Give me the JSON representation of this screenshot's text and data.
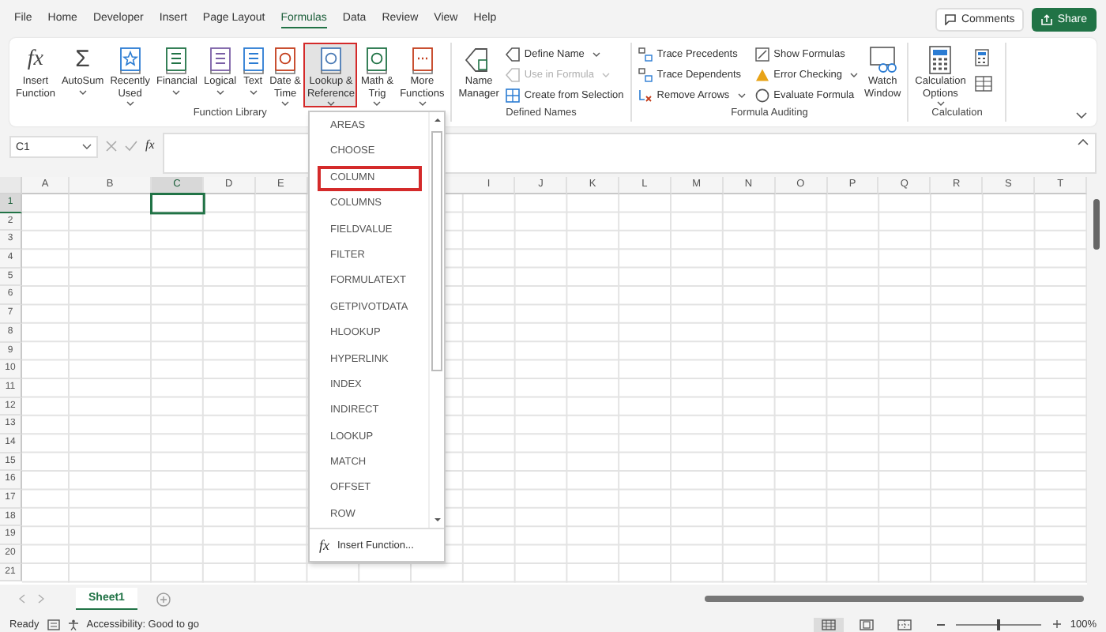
{
  "tabs": [
    {
      "label": "File",
      "selected": false
    },
    {
      "label": "Home",
      "selected": false
    },
    {
      "label": "Developer",
      "selected": false
    },
    {
      "label": "Insert",
      "selected": false
    },
    {
      "label": "Page Layout",
      "selected": false
    },
    {
      "label": "Formulas",
      "selected": true
    },
    {
      "label": "Data",
      "selected": false
    },
    {
      "label": "Review",
      "selected": false
    },
    {
      "label": "View",
      "selected": false
    },
    {
      "label": "Help",
      "selected": false
    }
  ],
  "top_buttons": {
    "comments": "Comments",
    "share": "Share"
  },
  "ribbon": {
    "groups": [
      {
        "kind": "functions",
        "label": "Function Library",
        "buttons": [
          {
            "kind": "fx",
            "icon_text": "fx",
            "lines": [
              "Insert",
              "Function"
            ],
            "dropdown": false,
            "selected": false
          },
          {
            "kind": "sigma",
            "icon_text": "Σ",
            "lines": [
              "AutoSum"
            ],
            "dropdown": true,
            "selected": false
          },
          {
            "kind": "star",
            "lines": [
              "Recently",
              "Used"
            ],
            "dropdown": true,
            "selected": false
          },
          {
            "kind": "db",
            "lines": [
              "Financial"
            ],
            "dropdown": true,
            "selected": false
          },
          {
            "kind": "question",
            "lines": [
              "Logical"
            ],
            "dropdown": true,
            "selected": false
          },
          {
            "kind": "text",
            "lines": [
              "Text"
            ],
            "dropdown": true,
            "selected": false
          },
          {
            "kind": "clock",
            "lines": [
              "Date &",
              "Time"
            ],
            "dropdown": true,
            "selected": false
          },
          {
            "kind": "search",
            "lines": [
              "Lookup &",
              "Reference"
            ],
            "dropdown": true,
            "selected": true
          },
          {
            "kind": "theta",
            "lines": [
              "Math &",
              "Trig"
            ],
            "dropdown": true,
            "selected": false
          },
          {
            "kind": "dots",
            "lines": [
              "More",
              "Functions"
            ],
            "dropdown": true,
            "selected": false
          }
        ]
      },
      {
        "kind": "names",
        "label": "Defined Names",
        "buttons": [
          {
            "kind": "tag",
            "lines": [
              "Name",
              "Manager"
            ],
            "dropdown": false,
            "selected": false
          }
        ],
        "items": [
          {
            "kind": "tag",
            "label": "Define Name",
            "dropdown": true,
            "disabled": false
          },
          {
            "kind": "tag",
            "label": "Use in Formula",
            "dropdown": true,
            "disabled": true
          },
          {
            "kind": "grid",
            "label": "Create from Selection",
            "dropdown": false,
            "disabled": false
          }
        ]
      },
      {
        "kind": "auditing",
        "label": "Formula Auditing",
        "buttons": [
          {
            "kind": "glasses",
            "lines": [
              "Watch",
              "Window"
            ],
            "dropdown": false,
            "selected": false
          }
        ],
        "items": [
          {
            "kind": "trace",
            "label": "Trace Precedents",
            "dropdown": false,
            "disabled": false
          },
          {
            "kind": "trace",
            "label": "Trace Dependents",
            "dropdown": false,
            "disabled": false
          },
          {
            "kind": "remove",
            "label": "Remove Arrows",
            "dropdown": true,
            "disabled": false
          },
          {
            "kind": "show",
            "label": "Show Formulas",
            "dropdown": false,
            "disabled": false
          },
          {
            "kind": "warn",
            "label": "Error Checking",
            "dropdown": true,
            "disabled": false
          },
          {
            "kind": "eval",
            "label": "Evaluate Formula",
            "dropdown": false,
            "disabled": false
          }
        ]
      },
      {
        "kind": "calculation",
        "label": "Calculation",
        "buttons": [
          {
            "kind": "calc",
            "lines": [
              "Calculation",
              "Options"
            ],
            "dropdown": true,
            "selected": false
          }
        ]
      }
    ]
  },
  "formula_bar": {
    "name_box": "C1",
    "fx_label": "fx"
  },
  "columns": [
    {
      "label": "A",
      "selected": false
    },
    {
      "label": "B",
      "selected": false
    },
    {
      "label": "C",
      "selected": true
    },
    {
      "label": "D",
      "selected": false
    },
    {
      "label": "E",
      "selected": false
    },
    {
      "label": "I",
      "selected": false
    },
    {
      "label": "J",
      "selected": false
    },
    {
      "label": "K",
      "selected": false
    },
    {
      "label": "L",
      "selected": false
    },
    {
      "label": "M",
      "selected": false
    },
    {
      "label": "N",
      "selected": false
    },
    {
      "label": "O",
      "selected": false
    },
    {
      "label": "P",
      "selected": false
    },
    {
      "label": "Q",
      "selected": false
    },
    {
      "label": "R",
      "selected": false
    },
    {
      "label": "S",
      "selected": false
    },
    {
      "label": "T",
      "selected": false
    }
  ],
  "rows": [
    {
      "label": "1",
      "selected": true
    },
    {
      "label": "2",
      "selected": false
    },
    {
      "label": "3",
      "selected": false
    },
    {
      "label": "4",
      "selected": false
    },
    {
      "label": "5",
      "selected": false
    },
    {
      "label": "6",
      "selected": false
    },
    {
      "label": "7",
      "selected": false
    },
    {
      "label": "8",
      "selected": false
    },
    {
      "label": "9",
      "selected": false
    },
    {
      "label": "10",
      "selected": false
    },
    {
      "label": "11",
      "selected": false
    },
    {
      "label": "12",
      "selected": false
    },
    {
      "label": "13",
      "selected": false
    },
    {
      "label": "14",
      "selected": false
    },
    {
      "label": "15",
      "selected": false
    },
    {
      "label": "16",
      "selected": false
    },
    {
      "label": "17",
      "selected": false
    },
    {
      "label": "18",
      "selected": false
    },
    {
      "label": "19",
      "selected": false
    },
    {
      "label": "20",
      "selected": false
    },
    {
      "label": "21",
      "selected": false
    }
  ],
  "menu": {
    "items": [
      {
        "label": "AREAS",
        "selected": false
      },
      {
        "label": "CHOOSE",
        "selected": false
      },
      {
        "label": "COLUMN",
        "selected": true
      },
      {
        "label": "COLUMNS",
        "selected": false
      },
      {
        "label": "FIELDVALUE",
        "selected": false
      },
      {
        "label": "FILTER",
        "selected": false
      },
      {
        "label": "FORMULATEXT",
        "selected": false
      },
      {
        "label": "GETPIVOTDATA",
        "selected": false
      },
      {
        "label": "HLOOKUP",
        "selected": false
      },
      {
        "label": "HYPERLINK",
        "selected": false
      },
      {
        "label": "INDEX",
        "selected": false
      },
      {
        "label": "INDIRECT",
        "selected": false
      },
      {
        "label": "LOOKUP",
        "selected": false
      },
      {
        "label": "MATCH",
        "selected": false
      },
      {
        "label": "OFFSET",
        "selected": false
      },
      {
        "label": "ROW",
        "selected": false
      }
    ],
    "footer": {
      "icon_text": "fx",
      "label": "Insert Function..."
    }
  },
  "sheets": [
    {
      "label": "Sheet1",
      "selected": true
    }
  ],
  "status": {
    "ready": "Ready",
    "accessibility": "Accessibility: Good to go",
    "views": [
      {
        "kind": "normal",
        "selected": true
      },
      {
        "kind": "page-layout",
        "selected": false
      },
      {
        "kind": "page-break",
        "selected": false
      }
    ],
    "zoom": {
      "level": 0.5,
      "label": "100%"
    }
  }
}
